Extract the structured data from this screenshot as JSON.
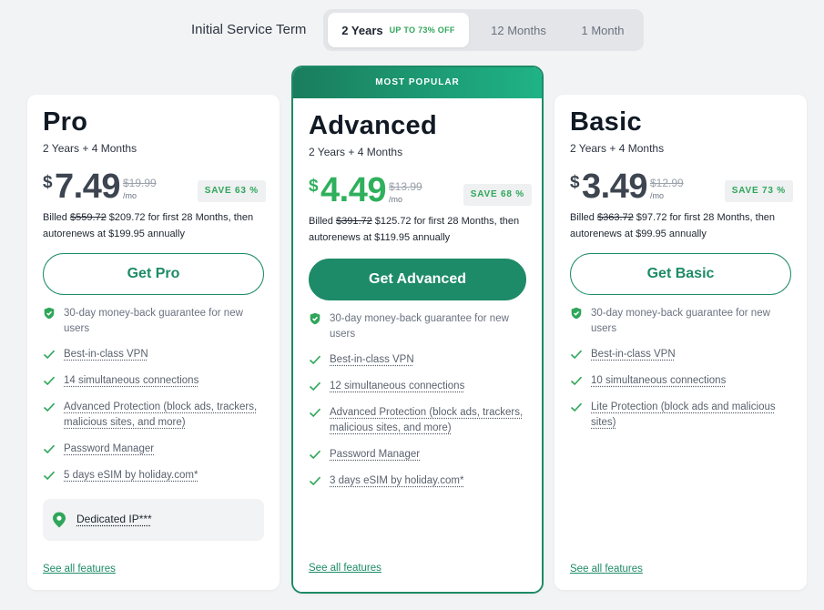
{
  "term_selector": {
    "label": "Initial Service Term",
    "options": [
      {
        "label": "2 Years",
        "badge": "UP TO 73% OFF",
        "active": true
      },
      {
        "label": "12 Months",
        "badge": "",
        "active": false
      },
      {
        "label": "1 Month",
        "badge": "",
        "active": false
      }
    ]
  },
  "colors": {
    "accent": "#1d8b67",
    "save_green": "#2fa65a",
    "price_green": "#2fb05c"
  },
  "plans": {
    "pro": {
      "name": "Pro",
      "term": "2 Years + 4 Months",
      "dollar": "$",
      "price": "7.49",
      "orig_price": "$19.99",
      "per": "/mo",
      "save": "SAVE 63 %",
      "billed_prefix": "Billed ",
      "billed_strike": "$559.72",
      "billed_rest": " $209.72 for first 28 Months, then autorenews at $199.95 annually",
      "cta": "Get Pro",
      "features": [
        "30-day money-back guarantee for new users",
        "Best-in-class VPN",
        "14 simultaneous connections",
        "Advanced Protection (block ads, trackers, malicious sites, and more)",
        "Password Manager",
        "5 days eSIM by holiday.com*"
      ],
      "dedicated": "Dedicated IP***",
      "see_all": "See all features"
    },
    "advanced": {
      "banner": "MOST POPULAR",
      "name": "Advanced",
      "term": "2 Years + 4 Months",
      "dollar": "$",
      "price": "4.49",
      "orig_price": "$13.99",
      "per": "/mo",
      "save": "SAVE 68 %",
      "billed_prefix": "Billed ",
      "billed_strike": "$391.72",
      "billed_rest": " $125.72 for first 28 Months, then autorenews at $119.95 annually",
      "cta": "Get Advanced",
      "features": [
        "30-day money-back guarantee for new users",
        "Best-in-class VPN",
        "12 simultaneous connections",
        "Advanced Protection (block ads, trackers, malicious sites, and more)",
        "Password Manager",
        "3 days eSIM by holiday.com*"
      ],
      "see_all": "See all features"
    },
    "basic": {
      "name": "Basic",
      "term": "2 Years + 4 Months",
      "dollar": "$",
      "price": "3.49",
      "orig_price": "$12.99",
      "per": "/mo",
      "save": "SAVE 73 %",
      "billed_prefix": "Billed ",
      "billed_strike": "$363.72",
      "billed_rest": " $97.72 for first 28 Months, then autorenews at $99.95 annually",
      "cta": "Get Basic",
      "features": [
        "30-day money-back guarantee for new users",
        "Best-in-class VPN",
        "10 simultaneous connections",
        "Lite Protection (block ads and malicious sites)"
      ],
      "see_all": "See all features"
    }
  }
}
